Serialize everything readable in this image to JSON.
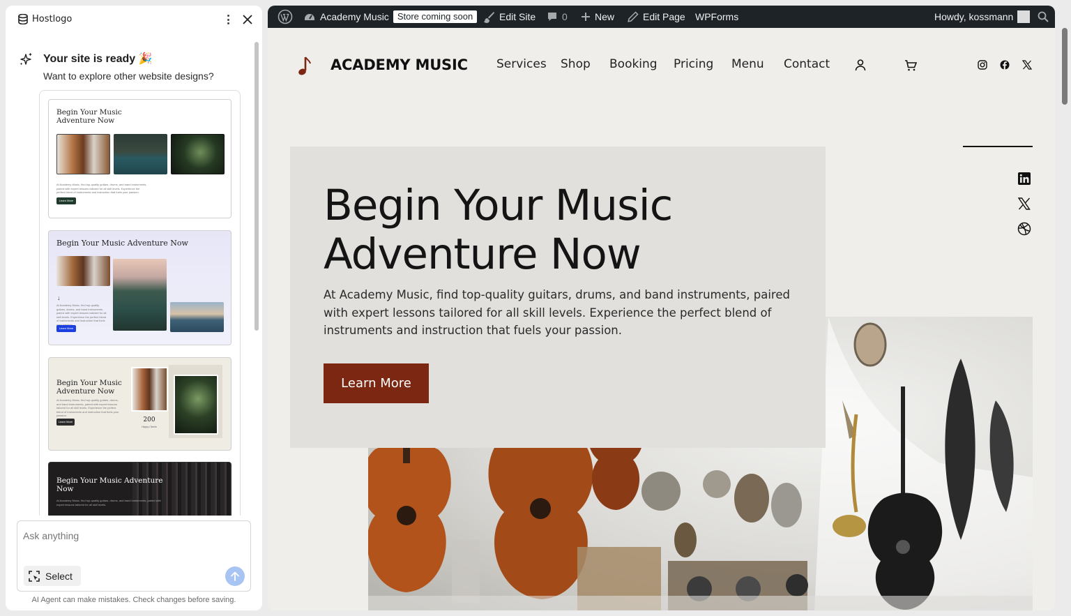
{
  "panel": {
    "brand": "Hostlogo",
    "ready_title": "Your site is ready 🎉",
    "ready_subtitle": "Want to explore other website designs?",
    "designs": [
      {
        "title_line1": "Begin Your Music",
        "title_line2": "Adventure Now",
        "button": "Learn More"
      },
      {
        "title": "Begin Your Music Adventure Now",
        "button": "Learn More"
      },
      {
        "title_line1": "Begin Your Music",
        "title_line2": "Adventure Now",
        "button": "Learn More",
        "stat_value": "200",
        "stat_label": "Happy Clients"
      },
      {
        "title_line1": "Begin Your Music Adventure",
        "title_line2": "Now"
      }
    ],
    "ask_placeholder": "Ask anything",
    "select_label": "Select",
    "disclaimer": "AI Agent can make mistakes. Check changes before saving."
  },
  "adminbar": {
    "site_name": "Academy Music",
    "store_badge": "Store coming soon",
    "edit_site": "Edit Site",
    "comments_count": "0",
    "new_label": "New",
    "edit_page": "Edit Page",
    "wpforms": "WPForms",
    "howdy": "Howdy, kossmann"
  },
  "site": {
    "title": "ACADEMY MUSIC",
    "nav": [
      "Services",
      "Shop",
      "Booking",
      "Pricing",
      "Menu",
      "Contact"
    ],
    "hero": {
      "title_line1": "Begin Your Music",
      "title_line2": "Adventure Now",
      "text": "At Academy Music, find top-quality guitars, drums, and band instruments, paired with expert lessons tailored for all skill levels. Experience the perfect blend of instruments and instruction that fuels your passion.",
      "button": "Learn More"
    }
  },
  "colors": {
    "accent_button": "#7b2712",
    "adminbar_bg": "#1d2327",
    "site_bg": "#f0eeeb",
    "hero_box_bg": "#e2e0dd",
    "send_button": "#a7c4f3"
  },
  "icons": [
    "database-icon",
    "kebab-menu-icon",
    "close-icon",
    "sparkle-icon",
    "select-frame-icon",
    "send-arrow-icon",
    "wordpress-icon",
    "dashboard-icon",
    "brush-icon",
    "comment-icon",
    "plus-icon",
    "pencil-icon",
    "search-icon",
    "music-note-icon",
    "user-icon",
    "cart-icon",
    "instagram-icon",
    "facebook-icon",
    "x-icon",
    "linkedin-icon",
    "dribbble-icon"
  ]
}
